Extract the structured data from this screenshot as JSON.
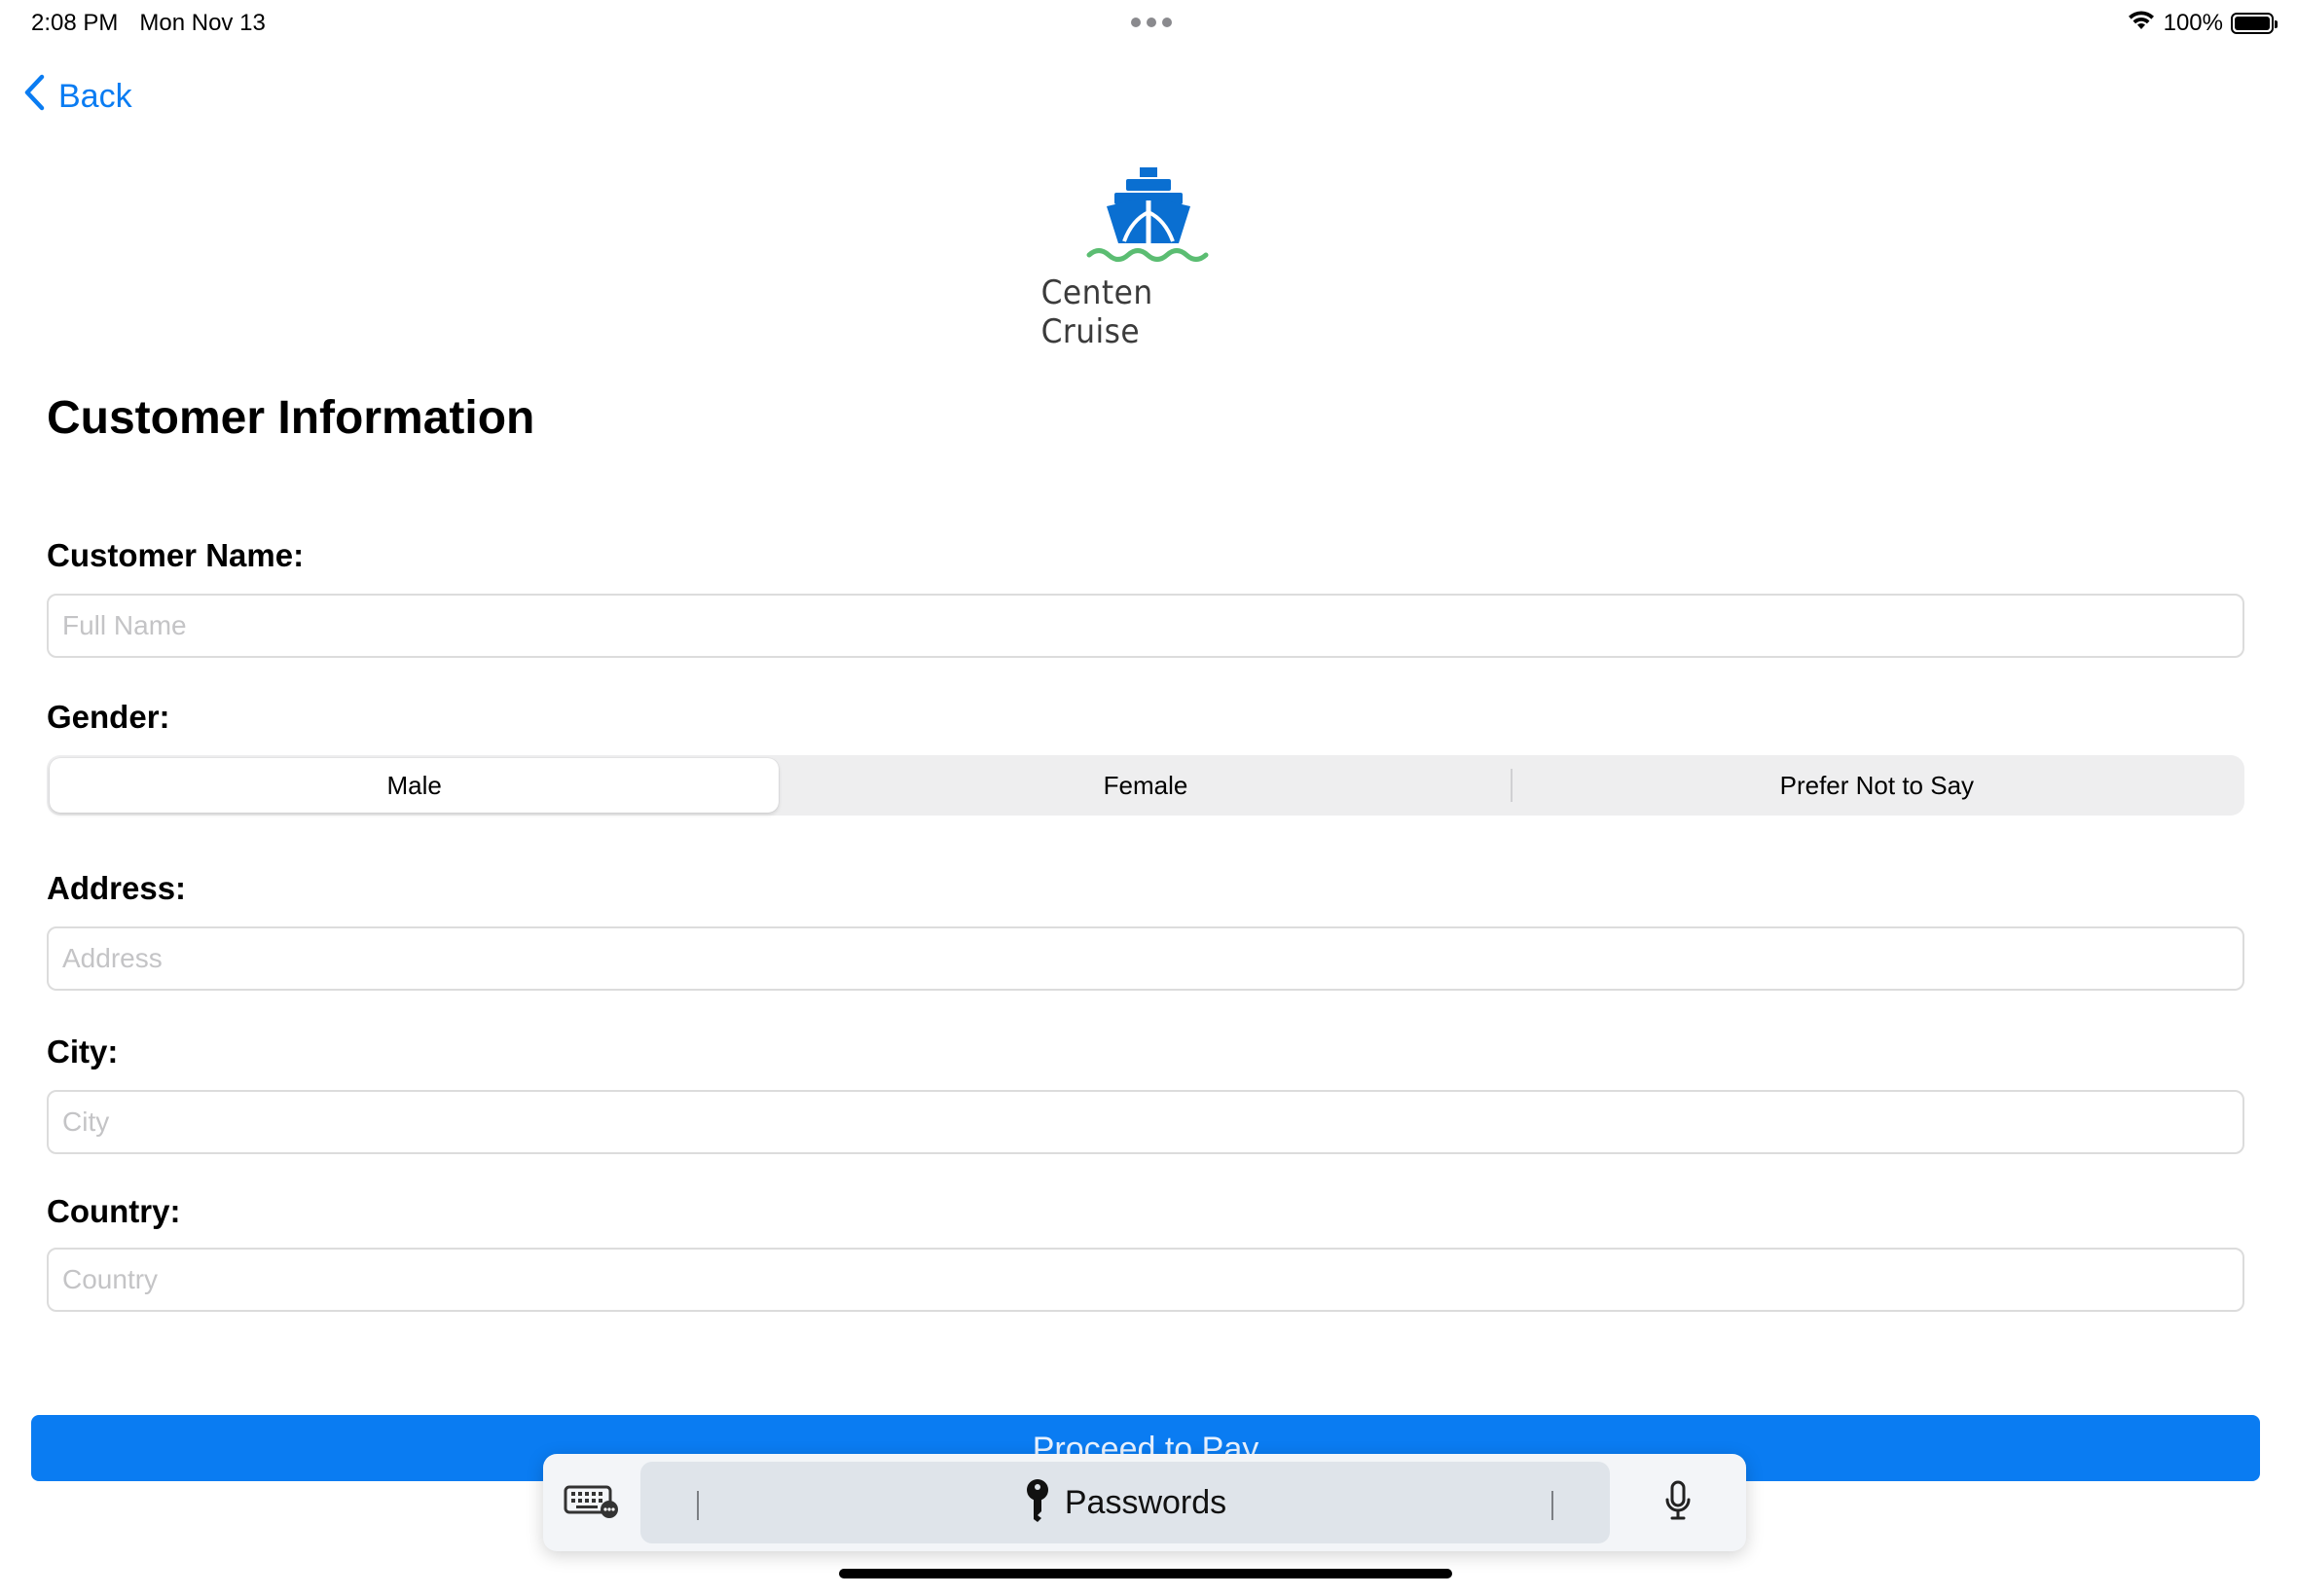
{
  "status_bar": {
    "time": "2:08 PM",
    "date": "Mon Nov 13",
    "battery_percent": "100%",
    "battery_level": 1.0
  },
  "nav": {
    "back_label": "Back"
  },
  "logo": {
    "text": "Centen Cruise",
    "icon": "ship-icon",
    "colors": {
      "ship": "#0a6fd1",
      "waves": "#5bbd72"
    }
  },
  "form": {
    "title": "Customer Information",
    "customer_name": {
      "label": "Customer Name:",
      "placeholder": "Full Name",
      "value": ""
    },
    "gender": {
      "label": "Gender:",
      "options": [
        "Male",
        "Female",
        "Prefer Not to Say"
      ],
      "selected": "Male"
    },
    "address": {
      "label": "Address:",
      "placeholder": "Address",
      "value": ""
    },
    "city": {
      "label": "City:",
      "placeholder": "City",
      "value": ""
    },
    "country": {
      "label": "Country:",
      "placeholder": "Country",
      "value": ""
    },
    "submit_label": "Proceed to Pay"
  },
  "keyboard_bar": {
    "passwords_label": "Passwords",
    "icons": [
      "keyboard-icon",
      "key-icon",
      "microphone-icon"
    ]
  },
  "colors": {
    "accent": "#0a7cf2",
    "field_border": "#dcdcdc",
    "placeholder": "#c4c4c6",
    "segment_bg": "#eeeeef"
  }
}
